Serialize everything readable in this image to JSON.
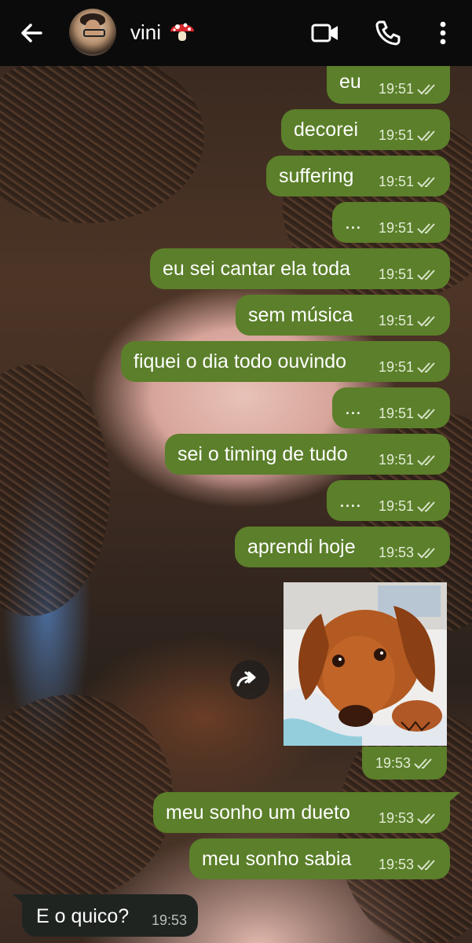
{
  "header": {
    "contact_name": "vini",
    "icons": [
      "back-arrow-icon",
      "avatar",
      "mushroom-emoji",
      "video-call-icon",
      "phone-icon",
      "more-vert-icon"
    ]
  },
  "messages": [
    {
      "text": "eu",
      "time": "19:51",
      "status": "read"
    },
    {
      "text": "decorei",
      "time": "19:51",
      "status": "read"
    },
    {
      "text": "suffering",
      "time": "19:51",
      "status": "read"
    },
    {
      "text": "...",
      "time": "19:51",
      "status": "read"
    },
    {
      "text": "eu sei cantar ela toda",
      "time": "19:51",
      "status": "read"
    },
    {
      "text": "sem música",
      "time": "19:51",
      "status": "read"
    },
    {
      "text": "fiquei o dia todo ouvindo",
      "time": "19:51",
      "status": "read"
    },
    {
      "text": "...",
      "time": "19:51",
      "status": "read"
    },
    {
      "text": "sei o timing de tudo",
      "time": "19:51",
      "status": "read"
    },
    {
      "text": "....",
      "time": "19:51",
      "status": "read"
    },
    {
      "text": "aprendi hoje",
      "time": "19:53",
      "status": "read"
    }
  ],
  "photo_message": {
    "time": "19:53",
    "status": "read",
    "subject": "dachshund puppy photo"
  },
  "messages2": [
    {
      "text": "meu sonho um dueto",
      "time": "19:53",
      "status": "read"
    },
    {
      "text": "meu sonho sabia",
      "time": "19:53",
      "status": "read"
    }
  ],
  "incoming": {
    "text": "E o quico?",
    "time": "19:53"
  },
  "colors": {
    "outgoing_bubble": "#5b7f2a",
    "incoming_bubble": "#1f2421",
    "header": "#0b0b0b"
  }
}
